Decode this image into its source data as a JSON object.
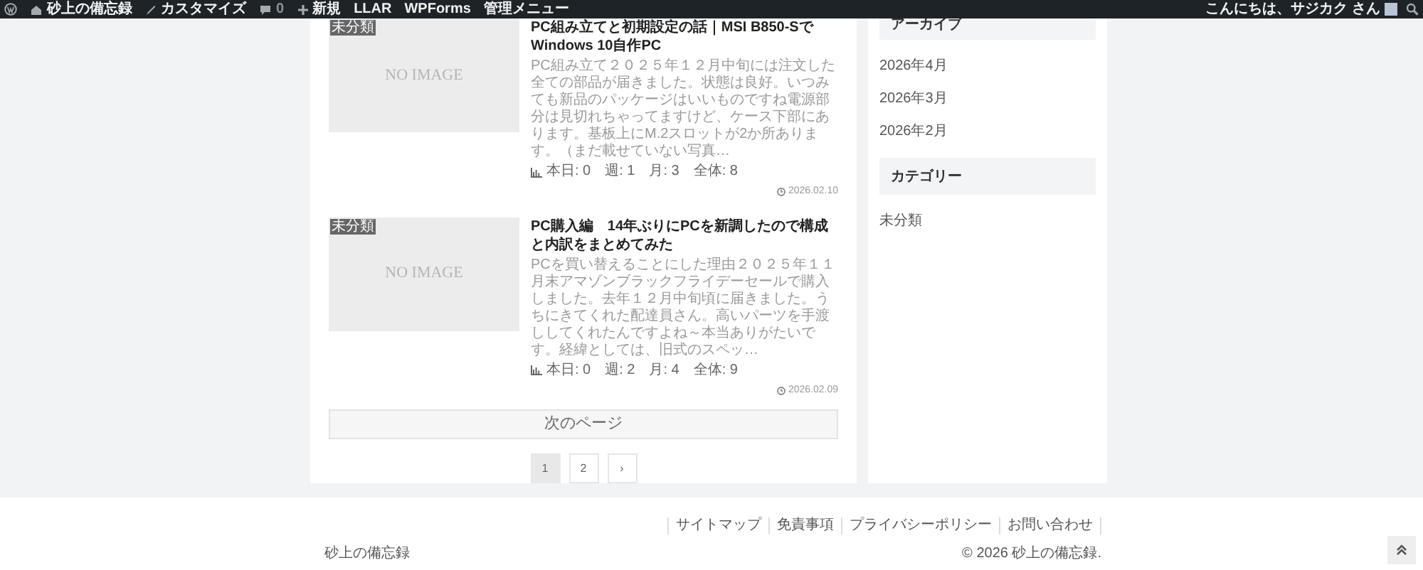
{
  "admin_bar": {
    "items": [
      {
        "kind": "logo"
      },
      {
        "kind": "home",
        "label": "砂上の備忘録"
      },
      {
        "kind": "customize",
        "label": "カスタマイズ"
      },
      {
        "kind": "comments",
        "label": "0"
      },
      {
        "kind": "new",
        "label": "新規"
      },
      {
        "kind": "text",
        "label": "LLAR"
      },
      {
        "kind": "text",
        "label": "WPForms"
      },
      {
        "kind": "text",
        "label": "管理メニュー"
      }
    ],
    "greeting": "こんにちは、サジカク さん"
  },
  "posts": [
    {
      "category": "未分類",
      "image_text": "NO IMAGE",
      "title": "PC組み立てと初期設定の話｜MSI B850-Sで Windows 10自作PC",
      "excerpt": "PC組み立て２０２５年１２月中旬には注文した全ての部品が届きました。状態は良好。いつみても新品のパッケージはいいものですね電源部分は見切れちゃってますけど、ケース下部にあります。基板上にM.2スロットが2か所あります。（まだ載せていない写真…",
      "stats": "本日: 0　週: 1　月: 3　全体: 8",
      "date": "2026.02.10"
    },
    {
      "category": "未分類",
      "image_text": "NO IMAGE",
      "title": "PC購入編　14年ぶりにPCを新調したので構成と内訳をまとめてみた",
      "excerpt": "PCを買い替えることにした理由２０２５年１１月末アマゾンブラックフライデーセールで購入しました。去年１２月中旬頃に届きました。うちにきてくれた配達員さん。高いパーツを手渡ししてくれたんですよね～本当ありがたいです。経緯としては、旧式のスペッ…",
      "stats": "本日: 0　週: 2　月: 4　全体: 9",
      "date": "2026.02.09"
    }
  ],
  "next_page": "次のページ",
  "pagination": [
    {
      "label": "1",
      "selected": true
    },
    {
      "label": "2",
      "selected": false
    },
    {
      "label": "›",
      "selected": false
    }
  ],
  "sidebar": {
    "widgets": [
      {
        "heading": "アーカイブ",
        "items": [
          "2026年4月",
          "2026年3月",
          "2026年2月"
        ]
      },
      {
        "heading": "カテゴリー",
        "items": [
          "未分類"
        ]
      }
    ]
  },
  "footer": {
    "links": [
      "サイトマップ",
      "免責事項",
      "プライバシーポリシー",
      "お問い合わせ"
    ],
    "site_name": "砂上の備忘録",
    "copyright": "© 2026 砂上の備忘録."
  }
}
